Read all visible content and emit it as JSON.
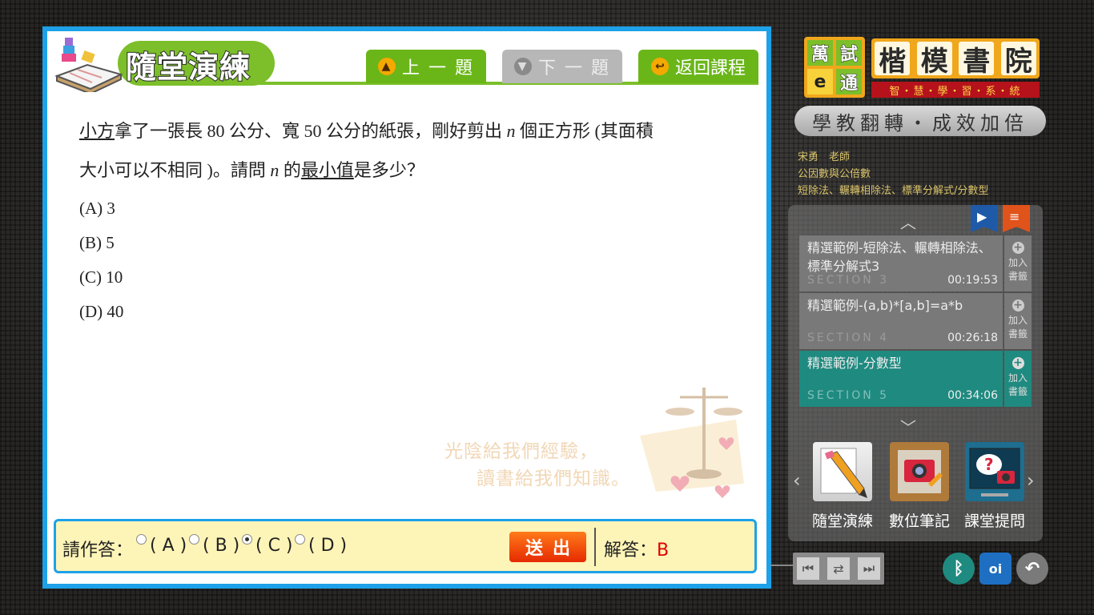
{
  "panel": {
    "title": "隨堂演練",
    "tabs": {
      "prev": {
        "label": "上 一 題",
        "icon": "arrow-up-icon"
      },
      "next": {
        "label": "下 一 題",
        "icon": "arrow-down-icon"
      },
      "back": {
        "label": "返回課程",
        "icon": "return-icon"
      }
    }
  },
  "question": {
    "line1": {
      "p1": "小方",
      "p2": "拿了一張長 80 公分、寬 50 公分的紙張，剛好剪出 ",
      "var": "n",
      "p3": " 個正方形 (其面積"
    },
    "line2": {
      "p1": "大小可以不相同 )。請問 ",
      "var": "n",
      "p2": " 的",
      "p3": "最小值",
      "p4": "是多少？"
    },
    "options": [
      "(A) 3",
      "(B) 5",
      "(C) 10",
      "(D) 40"
    ]
  },
  "watermark": {
    "line1": "光陰給我們經驗，",
    "line2": "讀書給我們知識。"
  },
  "answer": {
    "prompt": "請作答：",
    "choices": [
      "( A )",
      "( B )",
      "( C )",
      "( D )"
    ],
    "selected": "( C )",
    "submit_label": "送出",
    "solution_label": "解答：",
    "solution_value": "B"
  },
  "brand": {
    "square_chars": [
      "萬",
      "試",
      "e",
      "通"
    ],
    "name_chars": [
      "楷",
      "模",
      "書",
      "院"
    ],
    "subtitle": "智・慧・學・習・系・統",
    "slogan": "學教翻轉・成效加倍",
    "colors": {
      "orange": "#f0a71b",
      "green": "#7bbf2b",
      "red": "#b5121b"
    }
  },
  "lesson": {
    "teacher": "宋勇　老師",
    "topic": "公因數與公倍數",
    "subtopic": "短除法、輾轉相除法、標準分解式/分數型"
  },
  "video_list": {
    "items": [
      {
        "title": "精選範例-短除法、輾轉相除法、標準分解式3",
        "section": "SECTION 3",
        "time": "00:19:53",
        "bookmark": "加入書籤",
        "active": false
      },
      {
        "title": "精選範例-(a,b)*[a,b]=a*b",
        "section": "SECTION 4",
        "time": "00:26:18",
        "bookmark": "加入書籤",
        "active": false
      },
      {
        "title": "精選範例-分數型",
        "section": "SECTION 5",
        "time": "00:34:06",
        "bookmark": "加入書籤",
        "active": true
      }
    ],
    "active_color": "#1f8a80"
  },
  "tools": [
    {
      "label": "隨堂演練",
      "icon": "pencil-notebook-icon"
    },
    {
      "label": "數位筆記",
      "icon": "notebook-camera-icon"
    },
    {
      "label": "課堂提問",
      "icon": "question-monitor-icon"
    }
  ],
  "controls": {
    "nav": [
      "skip-back-icon",
      "loop-icon",
      "skip-forward-icon"
    ],
    "round": [
      "bluetooth-icon",
      "oi-icon",
      "undo-icon"
    ]
  },
  "colors": {
    "panel_border": "#1da1e8",
    "green": "#6ab619",
    "answer_bg": "#fdf4b7",
    "solution": "#e00000"
  }
}
